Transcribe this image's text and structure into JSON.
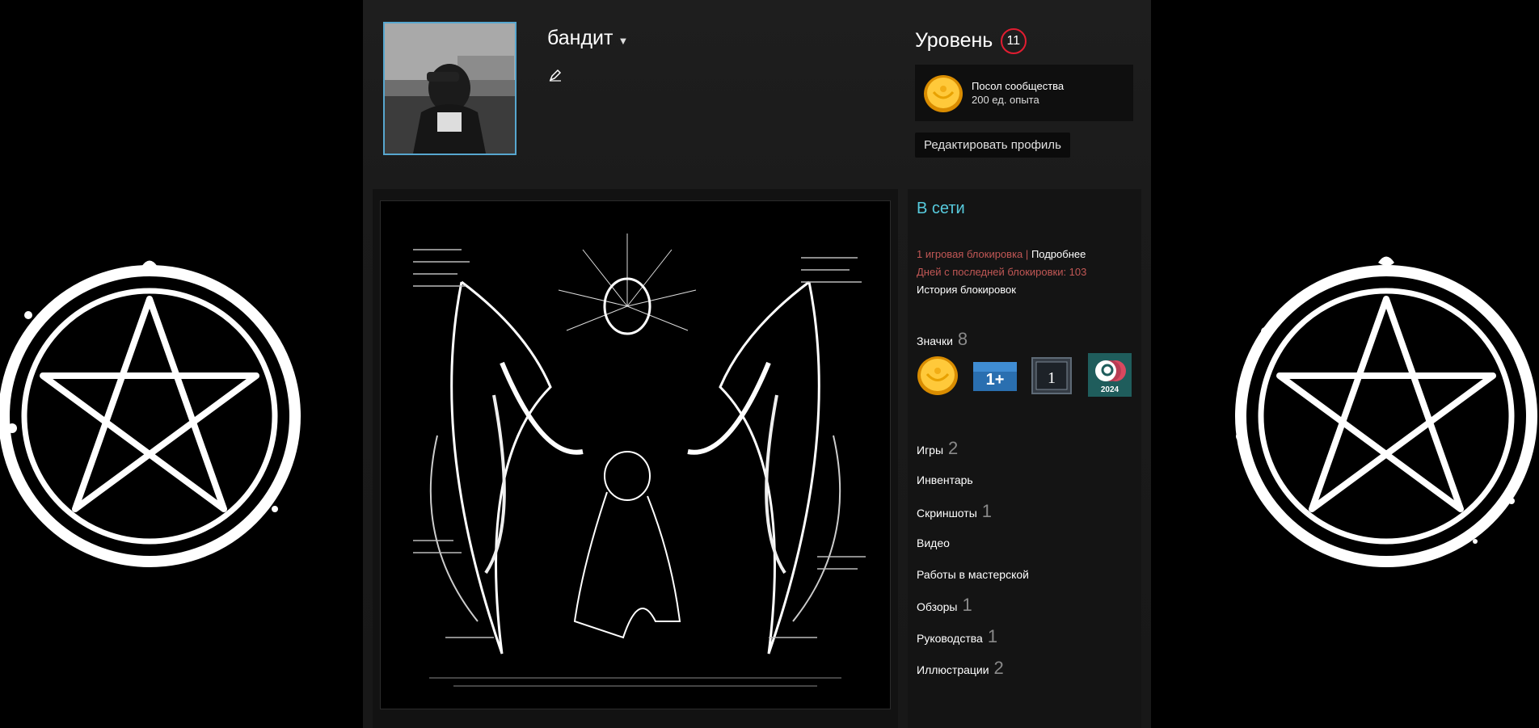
{
  "profile": {
    "persona_name": "бандит",
    "level_label": "Уровень",
    "level": "11",
    "favorite_badge": {
      "name": "Посол сообщества",
      "xp": "200 ед. опыта"
    },
    "edit_profile_label": "Редактировать профиль"
  },
  "status": {
    "online": "В сети",
    "ban_count": "1 игровая блокировка",
    "separator": "|",
    "details_link": "Подробнее",
    "days_since_ban": "Дней с последней блокировки: 103",
    "ban_history_link": "История блокировок"
  },
  "badges": {
    "label": "Значки",
    "count": "8",
    "items": [
      {
        "icon": "community-ambassador-badge-icon"
      },
      {
        "icon": "years-of-service-badge-icon",
        "text": "1+"
      },
      {
        "icon": "level-one-badge-icon",
        "text": "1"
      },
      {
        "icon": "steam-2024-badge-icon",
        "text": "2024"
      }
    ]
  },
  "nav": [
    {
      "label": "Игры",
      "count": "2"
    },
    {
      "label": "Инвентарь",
      "count": ""
    },
    {
      "label": "Скриншоты",
      "count": "1"
    },
    {
      "label": "Видео",
      "count": ""
    },
    {
      "label": "Работы в мастерской",
      "count": ""
    },
    {
      "label": "Обзоры",
      "count": "1"
    },
    {
      "label": "Руководства",
      "count": "1"
    },
    {
      "label": "Иллюстрации",
      "count": "2"
    }
  ],
  "colors": {
    "online": "#57cbde",
    "ban_text": "#c15755",
    "avatar_border": "#57a7cf",
    "level_ring": "#e21d31"
  }
}
